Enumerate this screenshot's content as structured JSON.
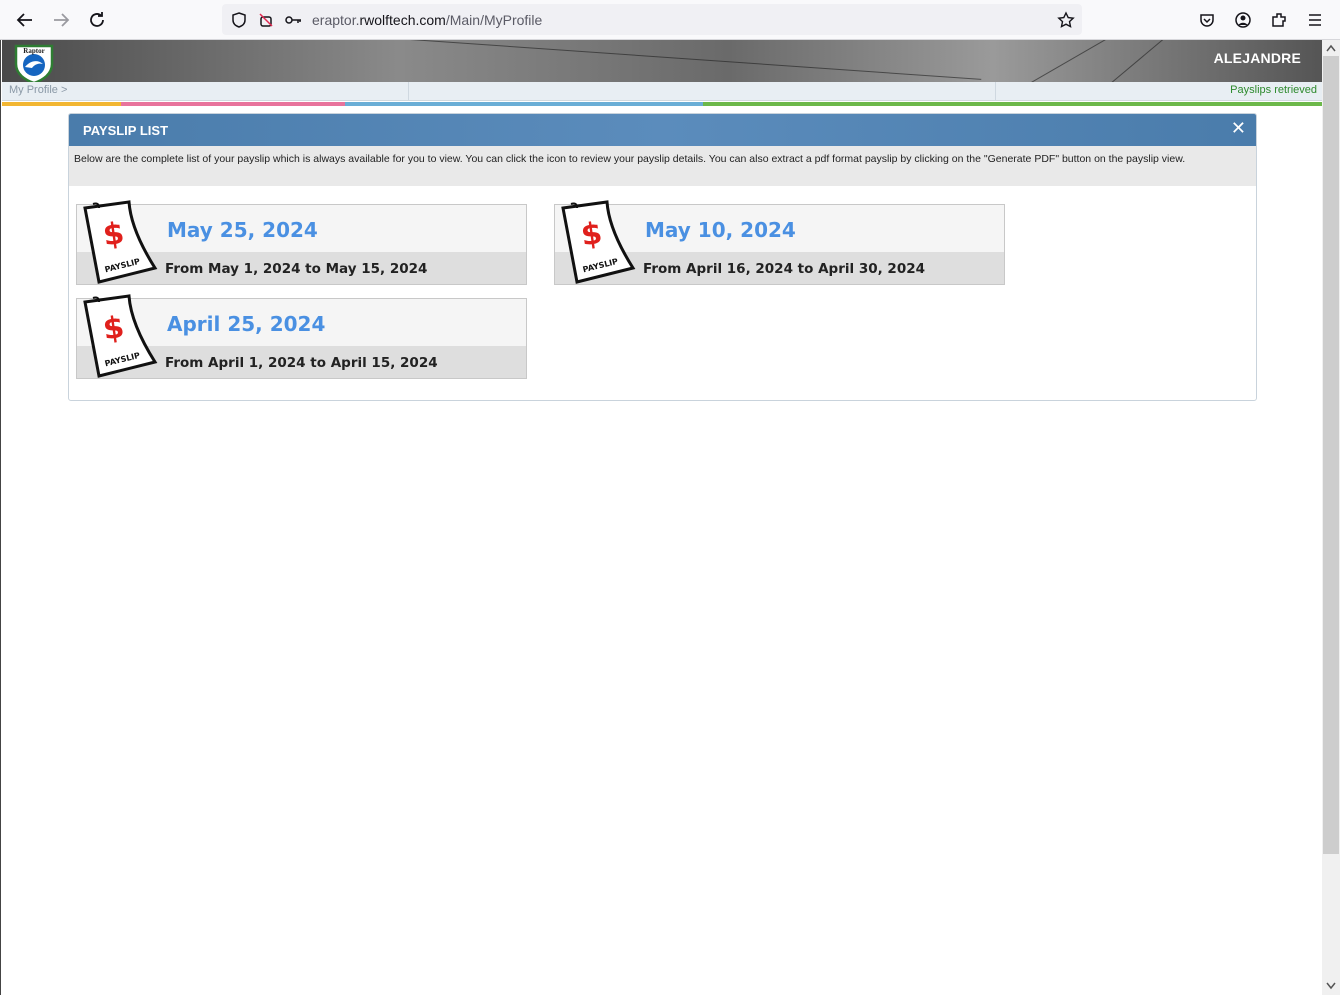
{
  "browser": {
    "url_prefix": "eraptor.",
    "url_host": "rwolftech.com",
    "url_path": "/Main/MyProfile"
  },
  "header": {
    "logo_text": "Raptor",
    "username": "ALEJANDRE",
    "breadcrumb": "My Profile  >",
    "status": "Payslips retrieved"
  },
  "panel": {
    "title": "PAYSLIP LIST",
    "close_glyph": "✕",
    "description": "Below are the complete list of your payslip which is always available for you to view. You can click the icon to review your payslip details. You can also extract a pdf format payslip by clicking on the \"Generate PDF\" button on the payslip view."
  },
  "payslips": [
    {
      "date": "May 25, 2024",
      "range": "From May 1, 2024 to May 15, 2024",
      "icon_label": "PAYSLIP"
    },
    {
      "date": "May 10, 2024",
      "range": "From April 16, 2024 to April 30, 2024",
      "icon_label": "PAYSLIP"
    },
    {
      "date": "April 25, 2024",
      "range": "From April 1, 2024 to April 15, 2024",
      "icon_label": "PAYSLIP"
    }
  ],
  "colors": {
    "accent_blue": "#4a90e2",
    "panel_header": "#4a7cab",
    "status_green": "#2d8a2d",
    "strip": [
      "#f2b632",
      "#e8739c",
      "#6aaed6",
      "#6cb84a"
    ]
  }
}
